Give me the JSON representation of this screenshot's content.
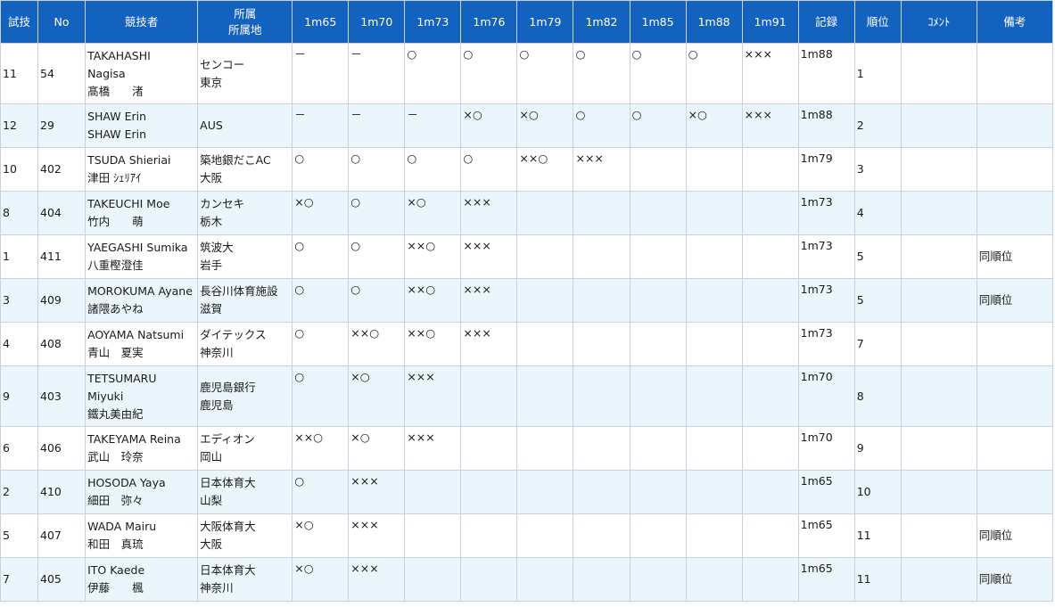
{
  "header": {
    "trial_order": "試技",
    "no": "No",
    "athlete": "競技者",
    "affiliation_top": "所属",
    "affiliation_bottom": "所属地",
    "heights": [
      "1m65",
      "1m70",
      "1m73",
      "1m76",
      "1m79",
      "1m82",
      "1m85",
      "1m88",
      "1m91"
    ],
    "mark": "記録",
    "place": "順位",
    "comment": "ｺﾒﾝﾄ",
    "remarks": "備考"
  },
  "rows": [
    {
      "order": "11",
      "no": "54",
      "name_lines": [
        "TAKAHASHI",
        "Nagisa",
        "髙橋　　渚"
      ],
      "club": "センコー",
      "region": "東京",
      "attempts": [
        "－",
        "－",
        "○",
        "○",
        "○",
        "○",
        "○",
        "○",
        "×××"
      ],
      "mark": "1m88",
      "place": "1",
      "comment": "",
      "remarks": ""
    },
    {
      "order": "12",
      "no": "29",
      "name_lines": [
        "SHAW Erin",
        "SHAW Erin"
      ],
      "club": "AUS",
      "region": "",
      "attempts": [
        "－",
        "－",
        "－",
        "×○",
        "×○",
        "○",
        "○",
        "×○",
        "×××"
      ],
      "mark": "1m88",
      "place": "2",
      "comment": "",
      "remarks": ""
    },
    {
      "order": "10",
      "no": "402",
      "name_lines": [
        "TSUDA Shieriai",
        "津田 ｼｪﾘｱｲ"
      ],
      "club": "築地銀だこAC",
      "region": "大阪",
      "attempts": [
        "○",
        "○",
        "○",
        "○",
        "××○",
        "×××",
        "",
        "",
        ""
      ],
      "mark": "1m79",
      "place": "3",
      "comment": "",
      "remarks": ""
    },
    {
      "order": "8",
      "no": "404",
      "name_lines": [
        "TAKEUCHI Moe",
        "竹内　　萌"
      ],
      "club": "カンセキ",
      "region": "栃木",
      "attempts": [
        "×○",
        "○",
        "×○",
        "×××",
        "",
        "",
        "",
        "",
        ""
      ],
      "mark": "1m73",
      "place": "4",
      "comment": "",
      "remarks": ""
    },
    {
      "order": "1",
      "no": "411",
      "name_lines": [
        "YAEGASHI Sumika",
        "八重樫澄佳"
      ],
      "club": "筑波大",
      "region": "岩手",
      "attempts": [
        "○",
        "○",
        "××○",
        "×××",
        "",
        "",
        "",
        "",
        ""
      ],
      "mark": "1m73",
      "place": "5",
      "comment": "",
      "remarks": "同順位"
    },
    {
      "order": "3",
      "no": "409",
      "name_lines": [
        "MOROKUMA Ayane",
        "諸隈あやね"
      ],
      "club": "長谷川体育施設",
      "region": "滋賀",
      "attempts": [
        "○",
        "○",
        "××○",
        "×××",
        "",
        "",
        "",
        "",
        ""
      ],
      "mark": "1m73",
      "place": "5",
      "comment": "",
      "remarks": "同順位"
    },
    {
      "order": "4",
      "no": "408",
      "name_lines": [
        "AOYAMA Natsumi",
        "青山　夏実"
      ],
      "club": "ダイテックス",
      "region": "神奈川",
      "attempts": [
        "○",
        "××○",
        "××○",
        "×××",
        "",
        "",
        "",
        "",
        ""
      ],
      "mark": "1m73",
      "place": "7",
      "comment": "",
      "remarks": ""
    },
    {
      "order": "9",
      "no": "403",
      "name_lines": [
        "TETSUMARU",
        "Miyuki",
        "鐵丸美由紀"
      ],
      "club": "鹿児島銀行",
      "region": "鹿児島",
      "attempts": [
        "○",
        "×○",
        "×××",
        "",
        "",
        "",
        "",
        "",
        ""
      ],
      "mark": "1m70",
      "place": "8",
      "comment": "",
      "remarks": ""
    },
    {
      "order": "6",
      "no": "406",
      "name_lines": [
        "TAKEYAMA Reina",
        "武山　玲奈"
      ],
      "club": "エディオン",
      "region": "岡山",
      "attempts": [
        "××○",
        "×○",
        "×××",
        "",
        "",
        "",
        "",
        "",
        ""
      ],
      "mark": "1m70",
      "place": "9",
      "comment": "",
      "remarks": ""
    },
    {
      "order": "2",
      "no": "410",
      "name_lines": [
        "HOSODA Yaya",
        "細田　弥々"
      ],
      "club": "日本体育大",
      "region": "山梨",
      "attempts": [
        "○",
        "×××",
        "",
        "",
        "",
        "",
        "",
        "",
        ""
      ],
      "mark": "1m65",
      "place": "10",
      "comment": "",
      "remarks": ""
    },
    {
      "order": "5",
      "no": "407",
      "name_lines": [
        "WADA Mairu",
        "和田　真琉"
      ],
      "club": "大阪体育大",
      "region": "大阪",
      "attempts": [
        "×○",
        "×××",
        "",
        "",
        "",
        "",
        "",
        "",
        ""
      ],
      "mark": "1m65",
      "place": "11",
      "comment": "",
      "remarks": "同順位"
    },
    {
      "order": "7",
      "no": "405",
      "name_lines": [
        "ITO Kaede",
        "伊藤　　楓"
      ],
      "club": "日本体育大",
      "region": "神奈川",
      "attempts": [
        "×○",
        "×××",
        "",
        "",
        "",
        "",
        "",
        "",
        ""
      ],
      "mark": "1m65",
      "place": "11",
      "comment": "",
      "remarks": "同順位"
    }
  ],
  "colors": {
    "header_bg": "#1462c0",
    "header_text": "#ffffff",
    "row_alt_bg": "#eaf6fc",
    "border": "#c7d3e3"
  }
}
